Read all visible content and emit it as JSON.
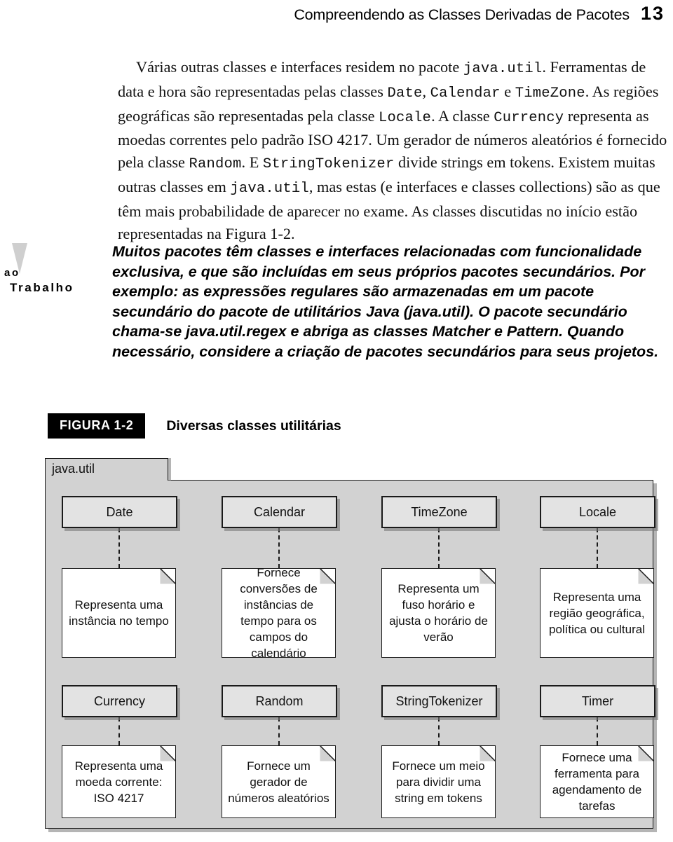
{
  "header": {
    "title": "Compreendendo as Classes Derivadas de Pacotes",
    "page_number": "13"
  },
  "body": {
    "paragraph_html": "Várias outras classes e interfaces residem no pacote <span class=\"mono\">java.util</span>. Ferramentas de data e hora são representadas pelas classes <span class=\"mono\">Date</span>, <span class=\"mono\">Calendar</span> e <span class=\"mono\">TimeZone</span>. As regiões geográficas são representadas pela classe <span class=\"mono\">Locale</span>. A classe <span class=\"mono\">Currency</span> representa as moedas correntes pelo padrão ISO 4217. Um gerador de números aleatórios é fornecido pela classe <span class=\"mono\">Random</span>. E <span class=\"mono\">StringTokenizer</span> divide strings em tokens. Existem muitas outras classes em <span class=\"mono\">java.util</span>, mas estas (e interfaces e classes collections) são as que têm mais probabilidade de aparecer no exame. As classes discutidas no início estão representadas na Figura 1-2."
  },
  "callout": {
    "icon": "exclamation-icon",
    "label_line1": "ao",
    "label_line2": "Trabalho",
    "text": "Muitos pacotes têm classes e interfaces relacionadas com funcionalidade exclusiva, e que são incluídas em seus próprios pacotes secundários. Por exemplo: as expressões regulares são armazenadas em um pacote secundário do pacote de utilitários Java (java.util). O pacote secundário chama-se java.util.regex e abriga as classes Matcher e Pattern. Quando necessário, considere a criação de pacotes secundários para seus projetos."
  },
  "figure": {
    "tag": "FIGURA 1-2",
    "title": "Diversas classes utilitárias",
    "package_name": "java.util",
    "rows": [
      {
        "classes": [
          "Date",
          "Calendar",
          "TimeZone",
          "Locale"
        ],
        "notes": [
          "Representa uma instância no tempo",
          "Fornece conversões de instâncias de tempo para os campos do calendário",
          "Representa um fuso horário e ajusta o horário de verão",
          "Representa uma região geográfica, política ou cultural"
        ]
      },
      {
        "classes": [
          "Currency",
          "Random",
          "StringTokenizer",
          "Timer"
        ],
        "notes": [
          "Representa uma moeda corrente: ISO 4217",
          "Fornece um gerador de números aleatórios",
          "Fornece um meio para dividir uma string em tokens",
          "Fornece uma ferramenta para agendamento de tarefas"
        ]
      }
    ]
  },
  "colors": {
    "package_fill": "#d2d2d2",
    "class_fill": "#e3e3e3",
    "note_fill": "#ffffff",
    "stroke": "#1a1a1a",
    "figure_tag_bg": "#000000",
    "icon_gray": "#cfcfcf"
  }
}
